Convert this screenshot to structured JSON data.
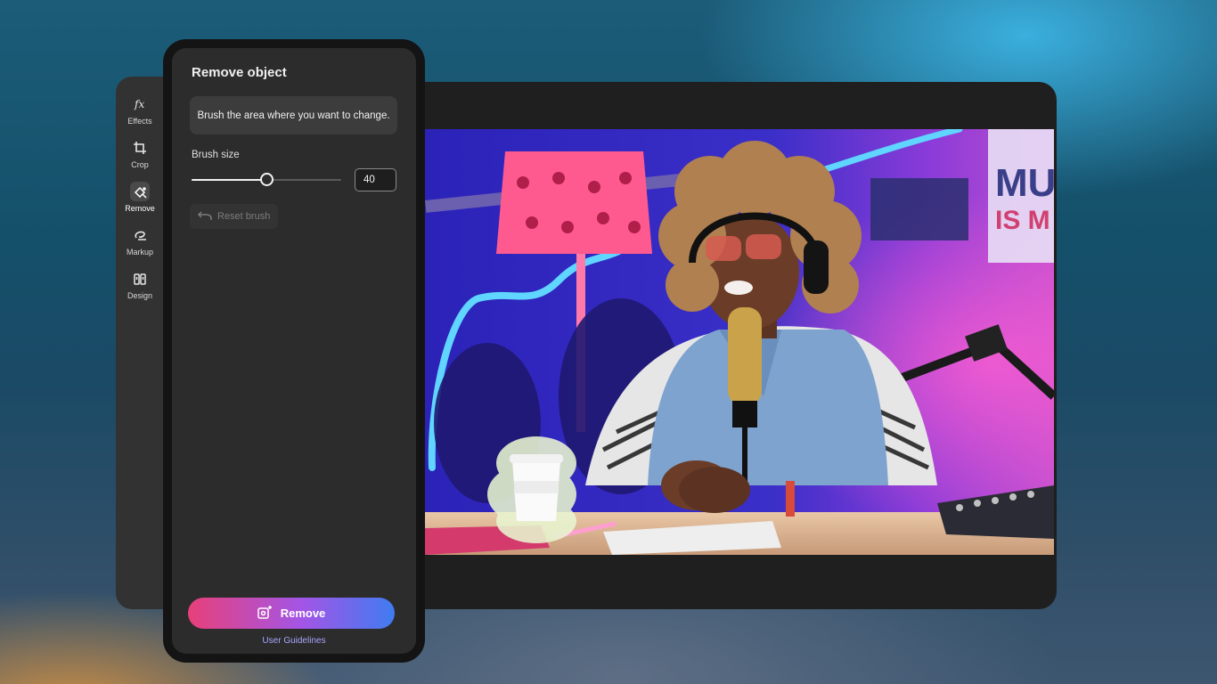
{
  "rail": {
    "items": [
      {
        "label": "Effects",
        "icon": "fx-icon",
        "active": false
      },
      {
        "label": "Crop",
        "icon": "crop-icon",
        "active": false
      },
      {
        "label": "Remove",
        "icon": "remove-icon",
        "active": true
      },
      {
        "label": "Markup",
        "icon": "markup-icon",
        "active": false
      },
      {
        "label": "Design",
        "icon": "design-icon",
        "active": false
      }
    ]
  },
  "panel": {
    "title": "Remove object",
    "hint": "Brush the area where you want to change.",
    "brush_size_label": "Brush size",
    "brush_size_value": "40",
    "brush_size_fraction": 0.5,
    "reset_label": "Reset brush",
    "remove_label": "Remove",
    "guidelines_label": "User Guidelines"
  },
  "canvas": {
    "image": "photo-of-podcast-host-with-microphone"
  },
  "colors": {
    "remove_gradient_start": "#e8407a",
    "remove_gradient_mid": "#a355e6",
    "remove_gradient_end": "#3f7cf0",
    "accent_link": "#a7a6ff"
  }
}
